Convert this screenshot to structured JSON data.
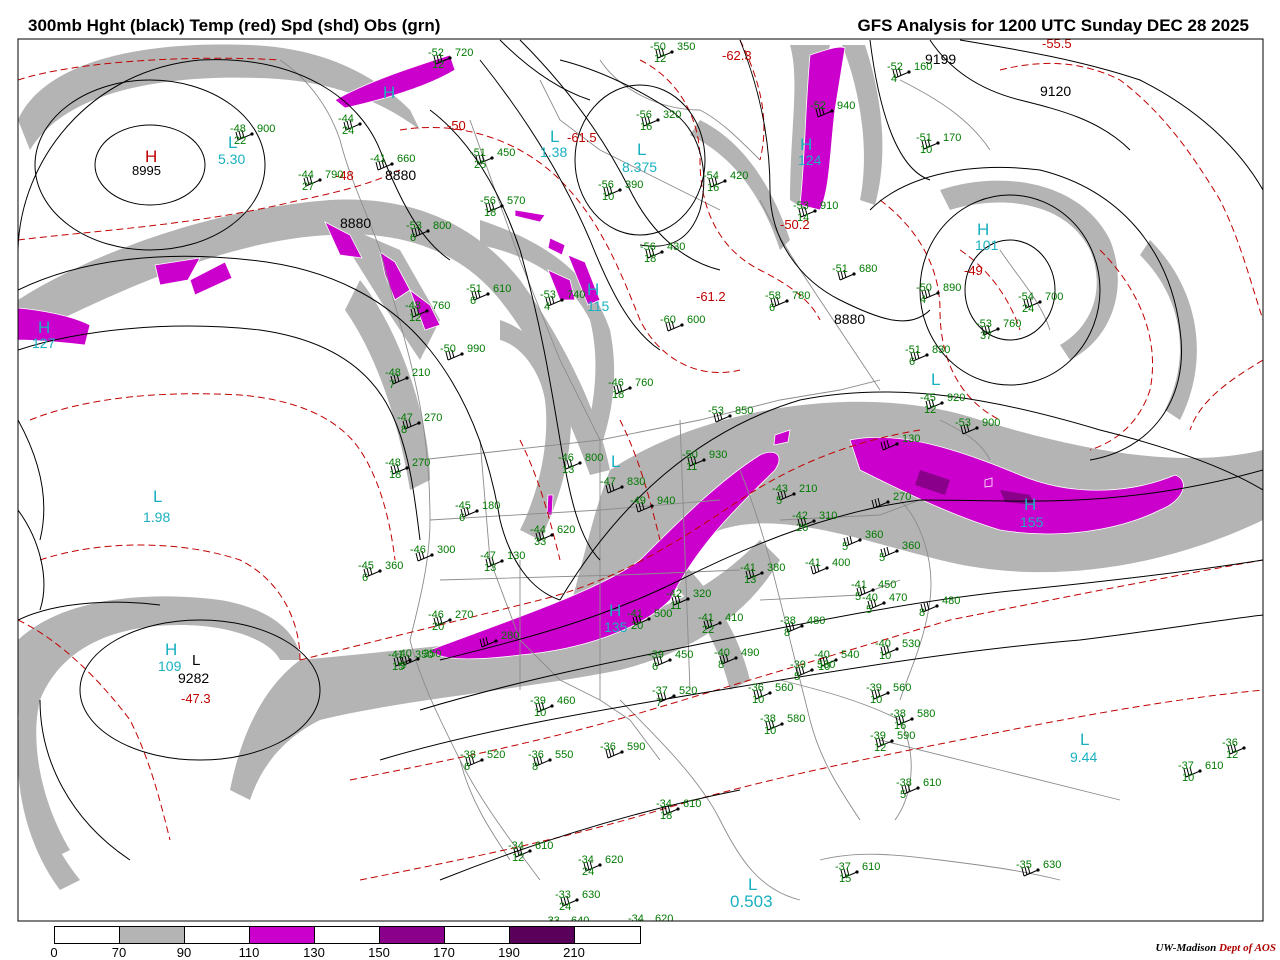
{
  "header": {
    "left_title": "300mb Hght (black) Temp (red) Spd (shd) Obs (grn)",
    "right_title": "GFS Analysis for 1200 UTC Sunday  DEC 28 2025"
  },
  "legend": {
    "ticks": [
      "0",
      "70",
      "90",
      "110",
      "130",
      "150",
      "170",
      "190",
      "210"
    ],
    "colors": [
      "#ffffff",
      "#b4b4b4",
      "#ffffff",
      "#cc00cc",
      "#ffffff",
      "#8b008b",
      "#ffffff",
      "#5a005a",
      "#ffffff"
    ]
  },
  "credit": {
    "org": "UW-Madison",
    "dept": "Dept of AOS"
  },
  "colors": {
    "height": "#000000",
    "temperature": "#c00000",
    "speed_70": "#b4b4b4",
    "speed_110": "#cc00cc",
    "speed_150": "#8b008b",
    "obs": "#007a00",
    "centers": "#1ab0c0",
    "borders": "#8c8c8c"
  },
  "height_labels": [
    "8880",
    "8880",
    "8880",
    "9199",
    "9120",
    "9282"
  ],
  "temp_labels": [
    "-55.5",
    "-62.3",
    "-61.5",
    "-50",
    "-50.2",
    "-61.2",
    "-49",
    "-47.3",
    "-48"
  ],
  "centers": [
    {
      "type": "H",
      "value": "8995",
      "kind": "height"
    },
    {
      "type": "L",
      "value": "5.30",
      "kind": "speed"
    },
    {
      "type": "H",
      "value": "",
      "kind": "speed"
    },
    {
      "type": "L",
      "value": "1.38",
      "kind": "speed"
    },
    {
      "type": "L",
      "value": "8.375",
      "kind": "speed"
    },
    {
      "type": "H",
      "value": "124",
      "kind": "speed"
    },
    {
      "type": "H",
      "value": "101",
      "kind": "speed"
    },
    {
      "type": "H",
      "value": "115",
      "kind": "speed"
    },
    {
      "type": "H",
      "value": "127",
      "kind": "speed"
    },
    {
      "type": "L",
      "value": "1.98",
      "kind": "speed"
    },
    {
      "type": "H",
      "value": "109",
      "kind": "speed"
    },
    {
      "type": "H",
      "value": "135",
      "kind": "speed"
    },
    {
      "type": "H",
      "value": "155",
      "kind": "speed"
    },
    {
      "type": "L",
      "value": "9.44",
      "kind": "speed"
    },
    {
      "type": "L",
      "value": "0.503",
      "kind": "speed"
    },
    {
      "type": "L",
      "value": "",
      "kind": "height"
    },
    {
      "type": "L",
      "value": "",
      "kind": "speed"
    },
    {
      "type": "L",
      "value": "",
      "kind": "speed"
    }
  ],
  "observations": [
    {
      "t": "-52",
      "h": "720",
      "d": "12"
    },
    {
      "t": "-50",
      "h": "350",
      "d": "12"
    },
    {
      "t": "-48",
      "h": "900",
      "d": "22"
    },
    {
      "t": "-44",
      "h": "",
      "d": "24"
    },
    {
      "t": "-41",
      "h": "660",
      "d": ""
    },
    {
      "t": "-44",
      "h": "790",
      "d": "27"
    },
    {
      "t": "-51",
      "h": "450",
      "d": "25"
    },
    {
      "t": "-56",
      "h": "320",
      "d": "16"
    },
    {
      "t": "-56",
      "h": "570",
      "d": "18"
    },
    {
      "t": "-56",
      "h": "390",
      "d": "10"
    },
    {
      "t": "-54",
      "h": "420",
      "d": "16"
    },
    {
      "t": "-56",
      "h": "430",
      "d": "18"
    },
    {
      "t": "-53",
      "h": "800",
      "d": "6"
    },
    {
      "t": "-51",
      "h": "610",
      "d": "6"
    },
    {
      "t": "-53",
      "h": "740",
      "d": "4"
    },
    {
      "t": "-52",
      "h": "160",
      "d": "4"
    },
    {
      "t": "-51",
      "h": "170",
      "d": "10"
    },
    {
      "t": "-51",
      "h": "680",
      "d": ""
    },
    {
      "t": "-50",
      "h": "890",
      "d": "4"
    },
    {
      "t": "-58",
      "h": "780",
      "d": "6"
    },
    {
      "t": "-60",
      "h": "600",
      "d": ""
    },
    {
      "t": "-48",
      "h": "760",
      "d": "12"
    },
    {
      "t": "-50",
      "h": "990",
      "d": ""
    },
    {
      "t": "-46",
      "h": "760",
      "d": "18"
    },
    {
      "t": "-48",
      "h": "210",
      "d": "7"
    },
    {
      "t": "-47",
      "h": "270",
      "d": "8"
    },
    {
      "t": "-48",
      "h": "270",
      "d": "18"
    },
    {
      "t": "-51",
      "h": "830",
      "d": "6"
    },
    {
      "t": "-45",
      "h": "920",
      "d": "12"
    },
    {
      "t": "-53",
      "h": "900",
      "d": ""
    },
    {
      "t": "-53",
      "h": "850",
      "d": ""
    },
    {
      "t": "-50",
      "h": "930",
      "d": "11"
    },
    {
      "t": "-46",
      "h": "800",
      "d": "13"
    },
    {
      "t": "-47",
      "h": "830",
      "d": ""
    },
    {
      "t": "-49",
      "h": "940",
      "d": ""
    },
    {
      "t": "-45",
      "h": "180",
      "d": "6"
    },
    {
      "t": "-44",
      "h": "620",
      "d": "33"
    },
    {
      "t": "-46",
      "h": "300",
      "d": ""
    },
    {
      "t": "-45",
      "h": "360",
      "d": "6"
    },
    {
      "t": "-47",
      "h": "130",
      "d": "13"
    },
    {
      "t": "-43",
      "h": "210",
      "d": "5"
    },
    {
      "t": "-42",
      "h": "310",
      "d": "26"
    },
    {
      "t": "",
      "h": "130",
      "d": ""
    },
    {
      "t": "",
      "h": "270",
      "d": ""
    },
    {
      "t": "",
      "h": "360",
      "d": "5"
    },
    {
      "t": "",
      "h": "360",
      "d": "5"
    },
    {
      "t": "-41",
      "h": "380",
      "d": "13"
    },
    {
      "t": "-41",
      "h": "400",
      "d": ""
    },
    {
      "t": "-41",
      "h": "450",
      "d": "5"
    },
    {
      "t": "-40",
      "h": "470",
      "d": "5"
    },
    {
      "t": "",
      "h": "480",
      "d": "8"
    },
    {
      "t": "-41",
      "h": "350",
      "d": "15"
    },
    {
      "t": "-46",
      "h": "270",
      "d": "20"
    },
    {
      "t": "-41",
      "h": "500",
      "d": "20"
    },
    {
      "t": "-42",
      "h": "320",
      "d": "11"
    },
    {
      "t": "-41",
      "h": "410",
      "d": "22"
    },
    {
      "t": "-39",
      "h": "450",
      "d": "6"
    },
    {
      "t": "-40",
      "h": "490",
      "d": "8"
    },
    {
      "t": "-38",
      "h": "480",
      "d": "8"
    },
    {
      "t": "-40",
      "h": "540",
      "d": "10"
    },
    {
      "t": "-40",
      "h": "530",
      "d": "10"
    },
    {
      "t": "-39",
      "h": "530",
      "d": "5"
    },
    {
      "t": "-36",
      "h": "560",
      "d": "10"
    },
    {
      "t": "-38",
      "h": "580",
      "d": "10"
    },
    {
      "t": "-39",
      "h": "560",
      "d": "10"
    },
    {
      "t": "-38",
      "h": "580",
      "d": "16"
    },
    {
      "t": "-39",
      "h": "590",
      "d": "12"
    },
    {
      "t": "-38",
      "h": "610",
      "d": "5"
    },
    {
      "t": "-37",
      "h": "520",
      "d": "7"
    },
    {
      "t": "-39",
      "h": "460",
      "d": "10"
    },
    {
      "t": "",
      "h": "280",
      "d": ""
    },
    {
      "t": "-40",
      "h": "350",
      "d": "9"
    },
    {
      "t": "-38",
      "h": "520",
      "d": "6"
    },
    {
      "t": "-36",
      "h": "550",
      "d": "8"
    },
    {
      "t": "-36",
      "h": "590",
      "d": ""
    },
    {
      "t": "-34",
      "h": "610",
      "d": "18"
    },
    {
      "t": "-34",
      "h": "610",
      "d": "12"
    },
    {
      "t": "-34",
      "h": "620",
      "d": "24"
    },
    {
      "t": "-33",
      "h": "630",
      "d": "24"
    },
    {
      "t": "-33",
      "h": "640",
      "d": ""
    },
    {
      "t": "-34",
      "h": "620",
      "d": ""
    },
    {
      "t": "-37",
      "h": "610",
      "d": "15"
    },
    {
      "t": "-35",
      "h": "630",
      "d": ""
    },
    {
      "t": "-37",
      "h": "610",
      "d": "10"
    },
    {
      "t": "-36",
      "h": "",
      "d": "12"
    },
    {
      "t": "-54",
      "h": "700",
      "d": "24"
    },
    {
      "t": "-53",
      "h": "760",
      "d": "37"
    },
    {
      "t": "-52",
      "h": "940",
      "d": ""
    },
    {
      "t": "-53",
      "h": "910",
      "d": "14"
    }
  ]
}
